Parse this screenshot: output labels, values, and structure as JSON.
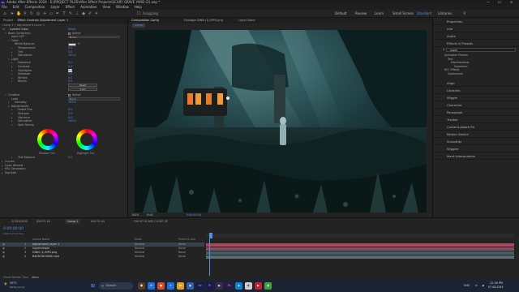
{
  "title_bar": {
    "text": "Adobe After Effects 2024 - E:\\PROJECT FILES\\After Effect Projects\\SCARY GRAVE YARD (2).aep *",
    "minimize": "—",
    "maximize": "☐",
    "close": "✕"
  },
  "menu": [
    "File",
    "Edit",
    "Composition",
    "Layer",
    "Effect",
    "Animation",
    "View",
    "Window",
    "Help"
  ],
  "workspaces": [
    {
      "label": "Default",
      "active": false
    },
    {
      "label": "Review",
      "active": false
    },
    {
      "label": "Learn",
      "active": false
    },
    {
      "label": "Small Screen",
      "active": false
    },
    {
      "label": "Standard",
      "active": true
    },
    {
      "label": "Libraries",
      "active": false
    }
  ],
  "toolbar": {
    "snapping": "Snapping"
  },
  "effect_controls": {
    "tab_project": "Project",
    "tab_effect": "Effect Controls Adjustment Layer 1",
    "breadcrumb": "Comp 1 • Adjustment Layer 1",
    "effect_name": "Lumetri Color",
    "effect_reset": "Reset",
    "basic_correction": "Basic Correction",
    "active_label": "Active",
    "input_lut_label": "Input LUT",
    "input_lut_value": "None",
    "color": "Color",
    "white_balance": "White Balance",
    "temperature": {
      "label": "Temperature",
      "value": "0.0"
    },
    "tint": {
      "label": "Tint",
      "value": "0.0"
    },
    "saturation": {
      "label": "Saturation",
      "value": "100.0"
    },
    "light": "Light",
    "exposure": {
      "label": "Exposure",
      "value": "0.0"
    },
    "contrast": {
      "label": "Contrast",
      "value": "0.0"
    },
    "highlights": {
      "label": "Highlights",
      "value": "0.0"
    },
    "shadows": {
      "label": "Shadows",
      "value": "0.0"
    },
    "whites": {
      "label": "Whites",
      "value": "0.0"
    },
    "blacks": {
      "label": "Blacks",
      "value": "0.0"
    },
    "reset_button": "Reset",
    "auto_button": "Auto",
    "creative": "Creative",
    "look_label": "Look",
    "look_value": "None",
    "intensity": {
      "label": "Intensity",
      "value": "100.0"
    },
    "adjustments": "Adjustments",
    "faded_film": {
      "label": "Faded Film",
      "value": "0.0"
    },
    "sharpen": {
      "label": "Sharpen",
      "value": "0.0"
    },
    "vibrance": {
      "label": "Vibrance",
      "value": "0.0"
    },
    "saturation2": {
      "label": "Saturation",
      "value": "100.0"
    },
    "split_toning": "Split Toning",
    "shadow_tint": "Shadow Tint",
    "highlight_tint": "Highlight Tint",
    "tint_balance": {
      "label": "Tint Balance",
      "value": "0.0"
    },
    "curves": "Curves",
    "color_wheels": "Color Wheels",
    "hsl_secondary": "HSL Secondary",
    "vignette": "Vignette"
  },
  "composition": {
    "tab": "Composition Comp",
    "footage_tab": "Footage DINN (1).MP4.png",
    "layer_tab": "Layer None",
    "sub_tab": "Comp",
    "zoom": "100%",
    "quality": "(Full)",
    "timecode": "0:00:00:00"
  },
  "right_panels": [
    {
      "label": "Properties",
      "icon": "properties-icon"
    },
    {
      "label": "Info",
      "icon": "info-icon"
    },
    {
      "label": "Audio",
      "icon": "audio-icon"
    },
    {
      "label": "Effects & Presets",
      "icon": "effects-icon"
    },
    {
      "label": "Align",
      "icon": "align-icon"
    },
    {
      "label": "Libraries",
      "icon": "libraries-icon"
    },
    {
      "label": "Wiggle",
      "icon": "wiggle-icon"
    },
    {
      "label": "Character",
      "icon": "character-icon"
    },
    {
      "label": "Paragraph",
      "icon": "paragraph-icon"
    },
    {
      "label": "Tracker",
      "icon": "tracker-icon"
    },
    {
      "label": "Content-Aware Fill",
      "icon": "content-aware-icon"
    },
    {
      "label": "Motion Sketch",
      "icon": "motion-sketch-icon"
    },
    {
      "label": "Smoother",
      "icon": "smoother-icon"
    },
    {
      "label": "Wiggler",
      "icon": "wiggler-icon"
    },
    {
      "label": "Mask Interpolation",
      "icon": "mask-interp-icon"
    }
  ],
  "effects_presets": {
    "search_value": "super",
    "tree": [
      "Animation Presets",
      "Text",
      "Miscellaneous",
      "Superhero",
      "BCC Effects",
      "Superscene"
    ]
  },
  "timeline": {
    "tabs": [
      {
        "label": "SCREAMING",
        "active": false
      },
      {
        "label": "Comp 1",
        "active": true
      },
      {
        "label": "KNOTS A3",
        "active": false
      },
      {
        "label": "KNOTS A5",
        "active": false
      },
      {
        "label": "GHOST SCARY CLOSE UP",
        "active": false
      }
    ],
    "timecode": "0:00:00:00",
    "fps": "00000 (25.00 fps)",
    "col_source": "Source Name",
    "col_mode": "Mode",
    "col_parent": "Parent & Link",
    "layers": [
      {
        "num": "1",
        "name": "Adjustment Layer 1",
        "mode": "Normal",
        "parent": "None",
        "color": "#cfcfcf",
        "bar": "#a7495e",
        "selected": true
      },
      {
        "num": "2",
        "name": "Supersimple",
        "mode": "Normal",
        "parent": "None",
        "color": "#cfcfcf",
        "bar": "#8f4a60",
        "selected": false
      },
      {
        "num": "3",
        "name": "DINN (1).MP4.png",
        "mode": "Normal",
        "parent": "None",
        "color": "#cfcfcf",
        "bar": "#3e6168",
        "selected": false
      },
      {
        "num": "4",
        "name": "BACKGROUND.mp4",
        "mode": "Normal",
        "parent": "None",
        "color": "#cfcfcf",
        "bar": "#5e6a72",
        "selected": false
      }
    ],
    "footer": "Frame Render Time",
    "footer_value": "40ms"
  },
  "taskbar": {
    "weather_temp": "29°C",
    "weather_desc": "Partly sunny",
    "search_placeholder": "Search",
    "time": "12:34 PM",
    "date": "07-06-2024",
    "lang": "ENG"
  },
  "colors": {
    "accent": "#4f8fe6",
    "timeline_playhead": "#4f8fe6",
    "panel": "#232323"
  }
}
